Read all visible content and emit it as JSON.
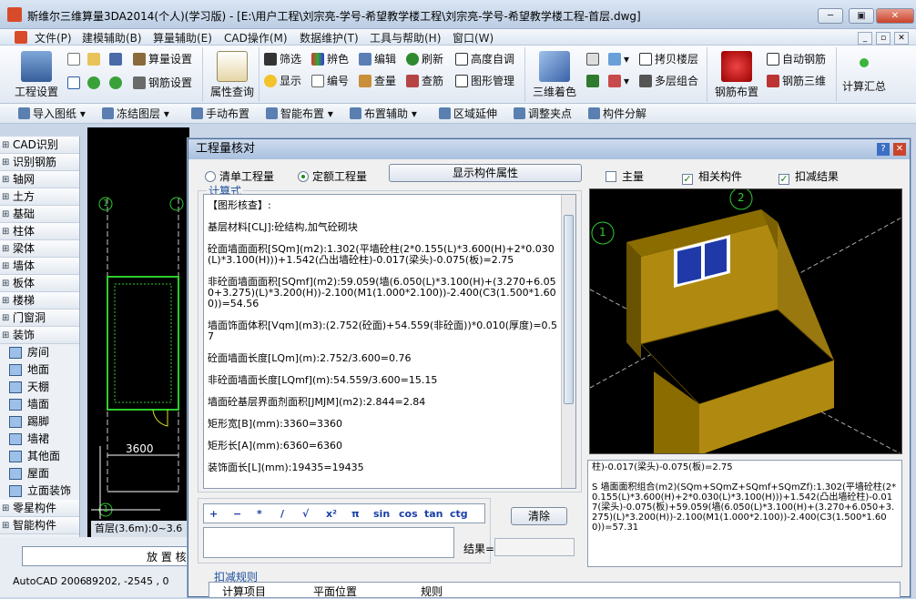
{
  "window": {
    "title": "斯维尔三维算量3DA2014(个人)(学习版) - [E:\\用户工程\\刘宗亮-学号-希望教学楼工程\\刘宗亮-学号-希望教学楼工程-首层.dwg]",
    "minimize": "─",
    "restore": "▣",
    "close": "✕"
  },
  "menu": [
    "文件(P)",
    "建模辅助(B)",
    "算量辅助(E)",
    "CAD操作(M)",
    "数据维护(T)",
    "工具与帮助(H)",
    "窗口(W)"
  ],
  "ribbon": {
    "project_settings": "工程设置",
    "quantity_settings": "算量设置",
    "rebar_settings": "钢筋设置",
    "attribute_query": "属性查询",
    "filter": "筛选",
    "display": "显示",
    "color_distinguish": "辨色",
    "number": "编号",
    "edit": "编辑",
    "check_quantity": "查量",
    "refresh": "刷新",
    "check_rebar": "查筋",
    "elevation_adjust": "高度自调",
    "graphic_management": "图形管理",
    "color_3d": "三维着色",
    "copy_floor": "拷贝楼层",
    "multi_floor_combine": "多层组合",
    "rebar_layout": "钢筋布置",
    "auto_rebar": "自动钢筋",
    "rebar_3d": "钢筋三维",
    "calc_summary": "计算汇总"
  },
  "toolbar2": [
    "导入图纸",
    "冻结图层",
    "手动布置",
    "智能布置",
    "布置辅助",
    "区域延伸",
    "调整夹点",
    "构件分解"
  ],
  "sidebar": {
    "categories_top": [
      "CAD识别",
      "识别钢筋",
      "轴网",
      "土方",
      "基础",
      "柱体",
      "梁体",
      "墙体",
      "板体",
      "楼梯",
      "门窗洞",
      "装饰"
    ],
    "items": [
      "房间",
      "地面",
      "天棚",
      "墙面",
      "踢脚",
      "墙裙",
      "其他面",
      "屋面",
      "立面装饰"
    ],
    "categories_bottom": [
      "零星构件",
      "智能构件"
    ]
  },
  "cad": {
    "axis_labels": [
      "1",
      "1"
    ],
    "dimension": "3600",
    "floor_tab": "首层(3.6m):0~3.6"
  },
  "statusbar": {
    "layout_text": "放 置 核",
    "app": "AutoCAD 2006",
    "coords": "89202, -2545 , 0"
  },
  "dialog": {
    "title": "工程量核对",
    "help": "?",
    "close": "✕",
    "radio_bill": "清单工程量",
    "radio_quota": "定额工程量",
    "show_attrs": "显示构件属性",
    "chk_main": "主量",
    "chk_related": "相关构件",
    "chk_deduct": "扣减结果",
    "formula_label": "计算式",
    "formula_lines": [
      "【图形核查】:",
      "基层材料[CLJ]:砼结构,加气砼砌块",
      "砼面墙面面积[SQm](m2):1.302(平墙砼柱(2*0.155(L)*3.600(H)+2*0.030(L)*3.100(H)))+1.542(凸出墙砼柱)-0.017(梁头)-0.075(板)=2.75",
      "非砼面墙面面积[SQmf](m2):59.059(墙(6.050(L)*3.100(H)+(3.270+6.050+3.275)(L)*3.200(H))-2.100(M1(1.000*2.100))-2.400(C3(1.500*1.600))=54.56",
      "墙面饰面体积[Vqm](m3):(2.752(砼面)+54.559(非砼面))*0.010(厚度)=0.57",
      "砼面墙面长度[LQm](m):2.752/3.600=0.76",
      "非砼面墙面长度[LQmf](m):54.559/3.600=15.15",
      "墙面砼基层界面剂面积[JMJM](m2):2.844=2.84",
      "矩形宽[B](mm):3360=3360",
      "矩形长[A](mm):6360=6360",
      "装饰面长[L](mm):19435=19435"
    ],
    "view_labels": [
      "1",
      "2"
    ],
    "result_text": "柱)-0.017(梁头)-0.075(板)=2.75\n\nS 墙面面积组合(m2)(SQm+SQmZ+SQmf+SQmZf):1.302(平墙砼柱(2*0.155(L)*3.600(H)+2*0.030(L)*3.100(H)))+1.542(凸出墙砼柱)-0.017(梁头)-0.075(板)+59.059(墙(6.050(L)*3.100(H)+(3.270+6.050+3.275)(L)*3.200(H))-2.100(M1(1.000*2.100))-2.400(C3(1.500*1.600))=57.31",
    "calc_keys": [
      "+",
      "−",
      "*",
      "/",
      "√",
      "x²",
      "π",
      "sin",
      "cos",
      "tan",
      "ctg"
    ],
    "clear": "清除",
    "result_label": "结果=",
    "deduct_rules_label": "扣减规则",
    "rule_headers": [
      "计算项目",
      "平面位置",
      "规则"
    ]
  },
  "colors": {
    "accent": "#1f4f9f",
    "cad_bg": "#000000",
    "wall": "#8a6a00"
  }
}
